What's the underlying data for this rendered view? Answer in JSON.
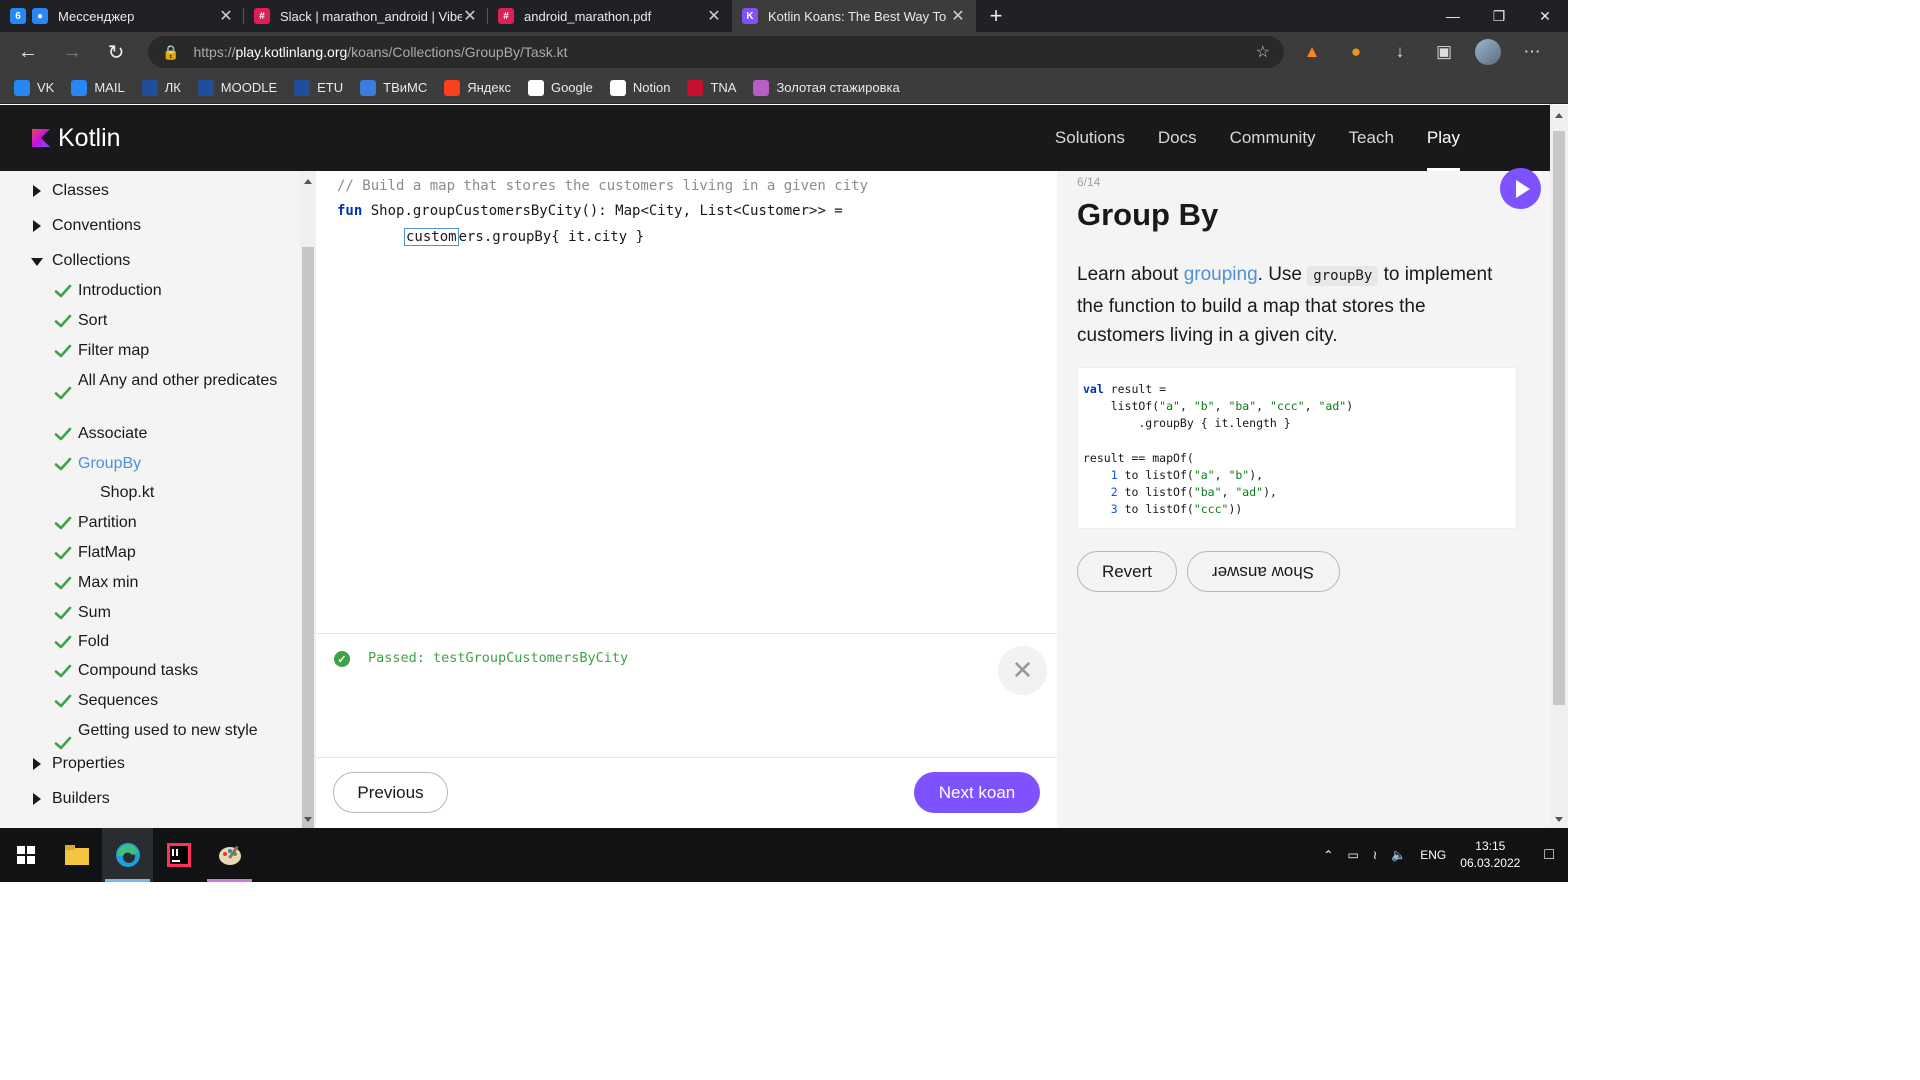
{
  "browser": {
    "tabs": [
      {
        "title": "Мессенджер",
        "icon": "messenger-icon",
        "color": "#2787f5"
      },
      {
        "title": "Slack | marathon_android | Vibelab",
        "icon": "slack-icon",
        "color": "#e01e5a"
      },
      {
        "title": "android_marathon.pdf",
        "icon": "slack-icon",
        "color": "#e01e5a"
      },
      {
        "title": "Kotlin Koans: The Best Way To Learn Kotlin",
        "icon": "kotlin-icon",
        "color": "#7f52ff"
      }
    ],
    "first_tab_badge": "6",
    "url_prefix": "https://",
    "url_host": "play.kotlinlang.org",
    "url_path": "/koans/Collections/GroupBy/Task.kt",
    "bookmarks": [
      {
        "label": "VK",
        "color": "#2787f5"
      },
      {
        "label": "MAIL",
        "color": "#2787f5"
      },
      {
        "label": "ЛК",
        "color": "#1f4e9a"
      },
      {
        "label": "MOODLE",
        "color": "#1f4e9a"
      },
      {
        "label": "ETU",
        "color": "#1f4e9a"
      },
      {
        "label": "ТВиМС",
        "color": "#3b7ddd"
      },
      {
        "label": "Яндекс",
        "color": "#fc3f1d"
      },
      {
        "label": "Google",
        "color": "#ffffff"
      },
      {
        "label": "Notion",
        "color": "#ffffff"
      },
      {
        "label": "TNA",
        "color": "#c8102e"
      },
      {
        "label": "Золотая стажировка",
        "color": "#b85cc8"
      }
    ]
  },
  "site": {
    "logo": "Kotlin",
    "nav": [
      "Solutions",
      "Docs",
      "Community",
      "Teach",
      "Play"
    ],
    "active_nav": "Play"
  },
  "sidebar": {
    "sections": {
      "classes": "Classes",
      "conventions": "Conventions",
      "collections": "Collections",
      "properties": "Properties",
      "builders": "Builders"
    },
    "items": [
      "Introduction",
      "Sort",
      "Filter map",
      "All Any and other predicates",
      "Associate",
      "GroupBy",
      "Partition",
      "FlatMap",
      "Max min",
      "Sum",
      "Fold",
      "Compound tasks",
      "Sequences",
      "Getting used to new style"
    ],
    "file": "Shop.kt",
    "current": "GroupBy"
  },
  "editor": {
    "line1": "// Build a map that stores the customers living in a given city",
    "line2_kw": "fun",
    "line2_rest": " Shop.groupCustomersByCity(): Map<City, List<Customer>> =",
    "line3_sel": "custom",
    "line3_rest": "ers.groupBy{ it.city }"
  },
  "results": {
    "passed": "Passed: testGroupCustomersByCity"
  },
  "footer": {
    "previous": "Previous",
    "next": "Next koan"
  },
  "task": {
    "counter": "6/14",
    "title": "Group By",
    "desc_1": "Learn about ",
    "desc_link": "grouping",
    "desc_2": ". Use ",
    "desc_code": "groupBy",
    "desc_3": " to implement the function to build a map that stores the customers living in a given city.",
    "revert": "Revert",
    "show_answer": "Show answer"
  },
  "taskbar": {
    "lang": "ENG",
    "time": "13:15",
    "date": "06.03.2022"
  }
}
